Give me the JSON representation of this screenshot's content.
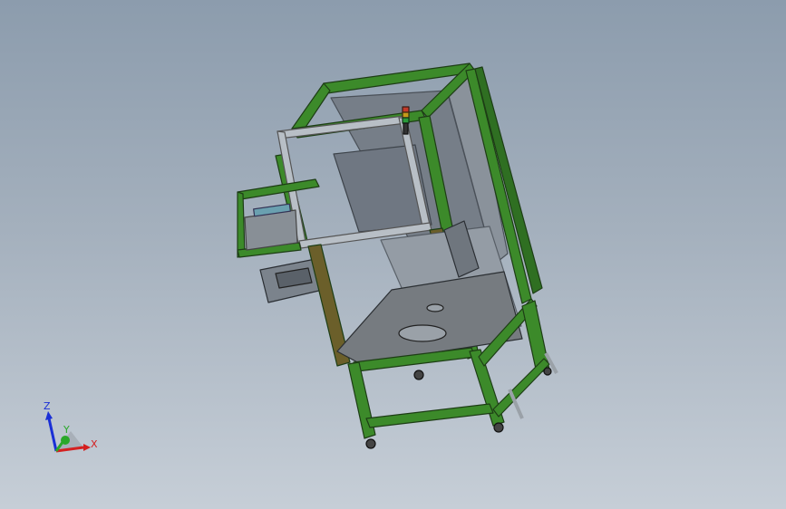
{
  "axes": {
    "z_label": "Z",
    "y_label": "Y",
    "x_label": "X",
    "z_color": "#1a2fd6",
    "y_color": "#2aa82a",
    "x_color": "#d42020"
  },
  "model": {
    "frame_color": "#3c8a2a",
    "frame_dark": "#23531a",
    "panel_color": "#6f7782",
    "post_color": "#6b5f2a"
  }
}
